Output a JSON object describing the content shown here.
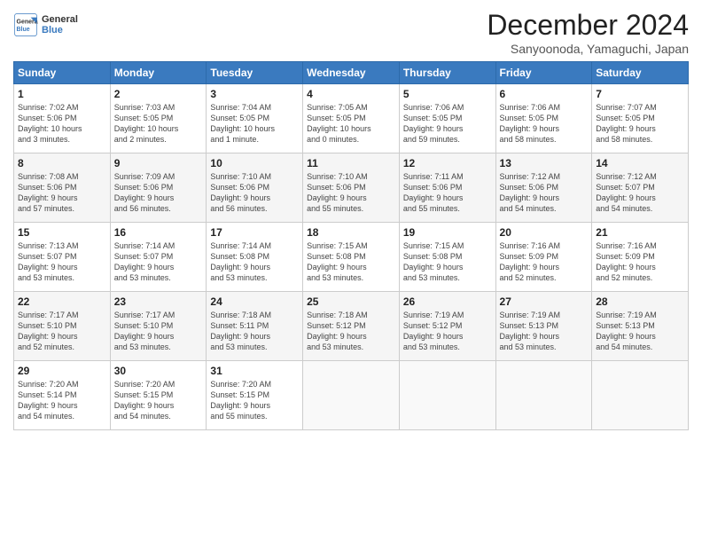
{
  "header": {
    "title": "December 2024",
    "location": "Sanyoonoda, Yamaguchi, Japan",
    "logo_line1": "General",
    "logo_line2": "Blue"
  },
  "weekdays": [
    "Sunday",
    "Monday",
    "Tuesday",
    "Wednesday",
    "Thursday",
    "Friday",
    "Saturday"
  ],
  "weeks": [
    [
      {
        "day": 1,
        "info": "Sunrise: 7:02 AM\nSunset: 5:06 PM\nDaylight: 10 hours\nand 3 minutes."
      },
      {
        "day": 2,
        "info": "Sunrise: 7:03 AM\nSunset: 5:05 PM\nDaylight: 10 hours\nand 2 minutes."
      },
      {
        "day": 3,
        "info": "Sunrise: 7:04 AM\nSunset: 5:05 PM\nDaylight: 10 hours\nand 1 minute."
      },
      {
        "day": 4,
        "info": "Sunrise: 7:05 AM\nSunset: 5:05 PM\nDaylight: 10 hours\nand 0 minutes."
      },
      {
        "day": 5,
        "info": "Sunrise: 7:06 AM\nSunset: 5:05 PM\nDaylight: 9 hours\nand 59 minutes."
      },
      {
        "day": 6,
        "info": "Sunrise: 7:06 AM\nSunset: 5:05 PM\nDaylight: 9 hours\nand 58 minutes."
      },
      {
        "day": 7,
        "info": "Sunrise: 7:07 AM\nSunset: 5:05 PM\nDaylight: 9 hours\nand 58 minutes."
      }
    ],
    [
      {
        "day": 8,
        "info": "Sunrise: 7:08 AM\nSunset: 5:06 PM\nDaylight: 9 hours\nand 57 minutes."
      },
      {
        "day": 9,
        "info": "Sunrise: 7:09 AM\nSunset: 5:06 PM\nDaylight: 9 hours\nand 56 minutes."
      },
      {
        "day": 10,
        "info": "Sunrise: 7:10 AM\nSunset: 5:06 PM\nDaylight: 9 hours\nand 56 minutes."
      },
      {
        "day": 11,
        "info": "Sunrise: 7:10 AM\nSunset: 5:06 PM\nDaylight: 9 hours\nand 55 minutes."
      },
      {
        "day": 12,
        "info": "Sunrise: 7:11 AM\nSunset: 5:06 PM\nDaylight: 9 hours\nand 55 minutes."
      },
      {
        "day": 13,
        "info": "Sunrise: 7:12 AM\nSunset: 5:06 PM\nDaylight: 9 hours\nand 54 minutes."
      },
      {
        "day": 14,
        "info": "Sunrise: 7:12 AM\nSunset: 5:07 PM\nDaylight: 9 hours\nand 54 minutes."
      }
    ],
    [
      {
        "day": 15,
        "info": "Sunrise: 7:13 AM\nSunset: 5:07 PM\nDaylight: 9 hours\nand 53 minutes."
      },
      {
        "day": 16,
        "info": "Sunrise: 7:14 AM\nSunset: 5:07 PM\nDaylight: 9 hours\nand 53 minutes."
      },
      {
        "day": 17,
        "info": "Sunrise: 7:14 AM\nSunset: 5:08 PM\nDaylight: 9 hours\nand 53 minutes."
      },
      {
        "day": 18,
        "info": "Sunrise: 7:15 AM\nSunset: 5:08 PM\nDaylight: 9 hours\nand 53 minutes."
      },
      {
        "day": 19,
        "info": "Sunrise: 7:15 AM\nSunset: 5:08 PM\nDaylight: 9 hours\nand 53 minutes."
      },
      {
        "day": 20,
        "info": "Sunrise: 7:16 AM\nSunset: 5:09 PM\nDaylight: 9 hours\nand 52 minutes."
      },
      {
        "day": 21,
        "info": "Sunrise: 7:16 AM\nSunset: 5:09 PM\nDaylight: 9 hours\nand 52 minutes."
      }
    ],
    [
      {
        "day": 22,
        "info": "Sunrise: 7:17 AM\nSunset: 5:10 PM\nDaylight: 9 hours\nand 52 minutes."
      },
      {
        "day": 23,
        "info": "Sunrise: 7:17 AM\nSunset: 5:10 PM\nDaylight: 9 hours\nand 53 minutes."
      },
      {
        "day": 24,
        "info": "Sunrise: 7:18 AM\nSunset: 5:11 PM\nDaylight: 9 hours\nand 53 minutes."
      },
      {
        "day": 25,
        "info": "Sunrise: 7:18 AM\nSunset: 5:12 PM\nDaylight: 9 hours\nand 53 minutes."
      },
      {
        "day": 26,
        "info": "Sunrise: 7:19 AM\nSunset: 5:12 PM\nDaylight: 9 hours\nand 53 minutes."
      },
      {
        "day": 27,
        "info": "Sunrise: 7:19 AM\nSunset: 5:13 PM\nDaylight: 9 hours\nand 53 minutes."
      },
      {
        "day": 28,
        "info": "Sunrise: 7:19 AM\nSunset: 5:13 PM\nDaylight: 9 hours\nand 54 minutes."
      }
    ],
    [
      {
        "day": 29,
        "info": "Sunrise: 7:20 AM\nSunset: 5:14 PM\nDaylight: 9 hours\nand 54 minutes."
      },
      {
        "day": 30,
        "info": "Sunrise: 7:20 AM\nSunset: 5:15 PM\nDaylight: 9 hours\nand 54 minutes."
      },
      {
        "day": 31,
        "info": "Sunrise: 7:20 AM\nSunset: 5:15 PM\nDaylight: 9 hours\nand 55 minutes."
      },
      null,
      null,
      null,
      null
    ]
  ]
}
